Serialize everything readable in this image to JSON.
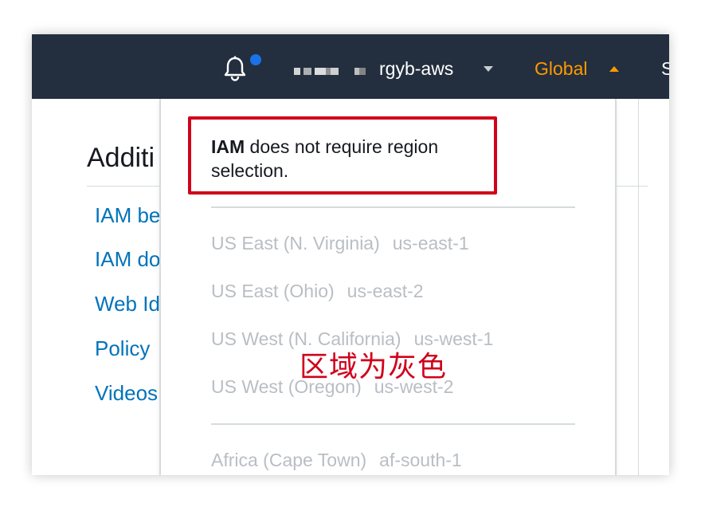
{
  "colors": {
    "nav_bg": "#232f3e",
    "region_accent": "#ff9900",
    "notification_dot": "#1a73e8",
    "link": "#0073bb",
    "disabled_text": "#b9bec4",
    "annotation_red": "#d0021b"
  },
  "topnav": {
    "notification_icon": "bell-icon",
    "account_name": "rgyb-aws",
    "account_caret_icon": "caret-down-icon",
    "region_label": "Global",
    "region_caret_icon": "caret-up-icon",
    "next_item_fragment": "S"
  },
  "page": {
    "section_heading": "Additi",
    "links": [
      "IAM be",
      "IAM do",
      "Web Id",
      "Policy",
      "Videos"
    ]
  },
  "region_dropdown": {
    "notice_bold": "IAM",
    "notice_text": " does not require region selection.",
    "regions": [
      {
        "name": "US East (N. Virginia)",
        "code": "us-east-1"
      },
      {
        "name": "US East (Ohio)",
        "code": "us-east-2"
      },
      {
        "name": "US West (N. California)",
        "code": "us-west-1"
      },
      {
        "name": "US West (Oregon)",
        "code": "us-west-2"
      },
      {
        "name": "Africa (Cape Town)",
        "code": "af-south-1"
      }
    ]
  },
  "annotation": {
    "text": "区域为灰色"
  }
}
